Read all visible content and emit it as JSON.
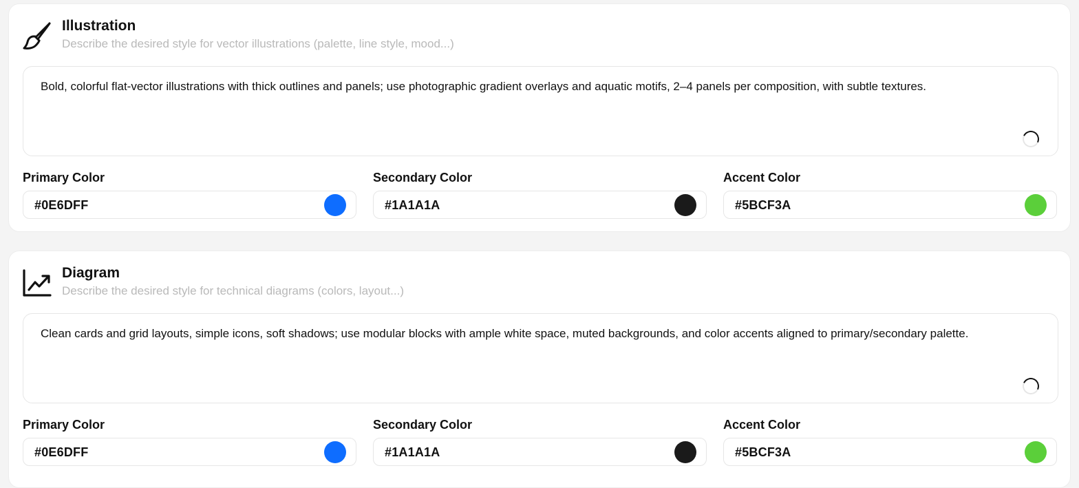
{
  "sections": [
    {
      "title": "Illustration",
      "subtitle": "Describe the desired style for vector illustrations (palette, line style, mood...)",
      "icon": "paintbrush-icon",
      "prompt": "Bold, colorful flat-vector illustrations with thick outlines and panels; use photographic gradient overlays and aquatic motifs, 2–4 panels per composition, with subtle textures.",
      "colors": {
        "primary": {
          "label": "Primary Color",
          "value": "#0E6DFF",
          "swatch": "#0E6DFF"
        },
        "secondary": {
          "label": "Secondary Color",
          "value": "#1A1A1A",
          "swatch": "#1A1A1A"
        },
        "accent": {
          "label": "Accent Color",
          "value": "#5BCF3A",
          "swatch": "#5BCF3A"
        }
      }
    },
    {
      "title": "Diagram",
      "subtitle": "Describe the desired style for technical diagrams (colors, layout...)",
      "icon": "trend-chart-icon",
      "prompt": "Clean cards and grid layouts, simple icons, soft shadows; use modular blocks with ample white space, muted backgrounds, and color accents aligned to primary/secondary palette.",
      "colors": {
        "primary": {
          "label": "Primary Color",
          "value": "#0E6DFF",
          "swatch": "#0E6DFF"
        },
        "secondary": {
          "label": "Secondary Color",
          "value": "#1A1A1A",
          "swatch": "#1A1A1A"
        },
        "accent": {
          "label": "Accent Color",
          "value": "#5BCF3A",
          "swatch": "#5BCF3A"
        }
      }
    }
  ]
}
